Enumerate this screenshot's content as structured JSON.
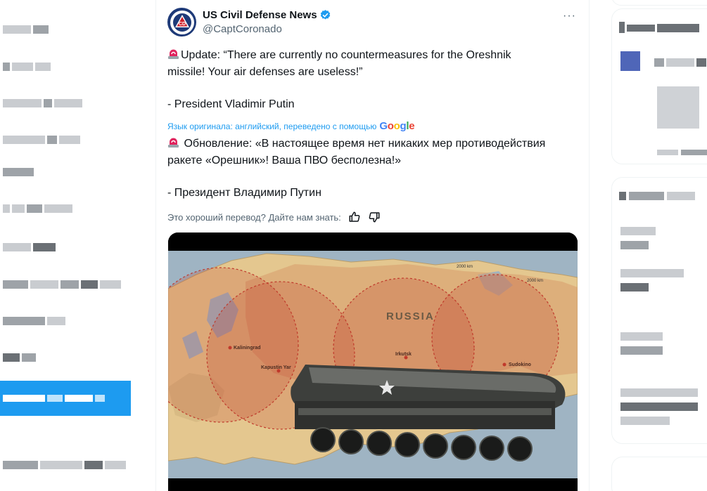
{
  "tweet": {
    "author_name": "US Civil Defense News",
    "author_handle": "@CaptCoronado",
    "more_label": "···",
    "text_en": [
      "Update: “There are currently no countermeasures for the Oreshnik",
      "missile! Your air defenses are useless!”",
      "",
      "- President Vladimir Putin"
    ],
    "translation_note": "Язык оригинала: английский, переведено с помощью",
    "translation_provider": "Google",
    "text_ru": [
      "Обновление: «В настоящее время нет никаких мер противодействия",
      "ракете «Орешник»! Ваша ПВО бесполезна!»",
      "",
      "- Президент Владимир Путин"
    ],
    "rate_prompt": "Это хороший перевод? Дайте нам знать:",
    "icons": {
      "siren": "police-light-icon",
      "verified": "verified-badge-icon",
      "thumbs_up": "thumbs-up-icon",
      "thumbs_down": "thumbs-down-icon",
      "more": "more-options-icon"
    },
    "media": {
      "map_labels": {
        "country": "RUSSIA",
        "cities": [
          "Kaliningrad",
          "Kapustin Yar",
          "Irkutsk",
          "Sudokino"
        ],
        "ranges": [
          "2000 km",
          "2000 km"
        ]
      }
    }
  },
  "colors": {
    "accent": "#1d9bf0",
    "text": "#0f1419",
    "muted": "#536471",
    "avatar_bg": "#1e3a78",
    "siren": "#e0245e",
    "range_circle": "#c0392b"
  }
}
